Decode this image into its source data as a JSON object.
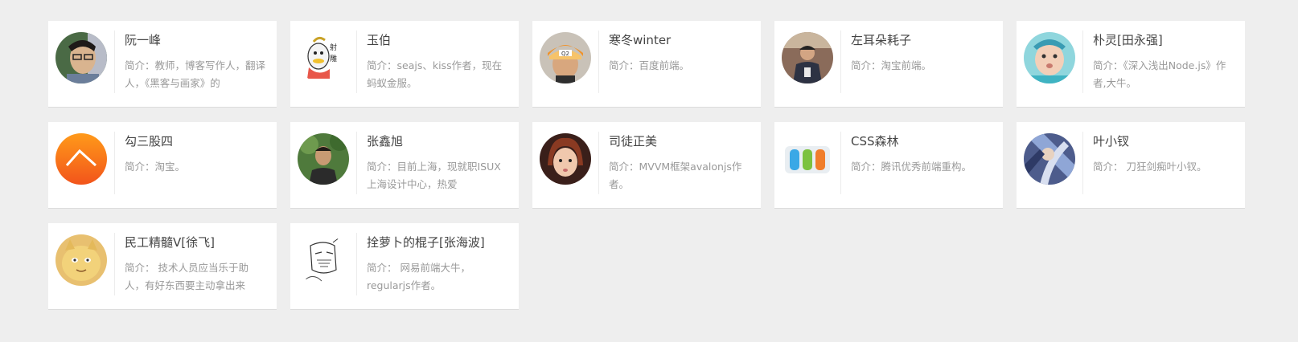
{
  "authors": [
    {
      "name": "阮一峰",
      "bio": "简介：教师，博客写作人，翻译人，《黑客与画家》的",
      "avatar": "photo-avatar"
    },
    {
      "name": "玉伯",
      "bio": "简介：seajs、kiss作者，现在蚂蚁金服。",
      "avatar": "cartoon-duck-avatar"
    },
    {
      "name": "寒冬winter",
      "bio": "简介：百度前端。",
      "avatar": "photo-avatar"
    },
    {
      "name": "左耳朵耗子",
      "bio": "简介：淘宝前端。",
      "avatar": "photo-avatar"
    },
    {
      "name": "朴灵[田永强]",
      "bio": "简介：《深入浅出Node.js》作者,大牛。",
      "avatar": "baby-photo-avatar"
    },
    {
      "name": "勾三股四",
      "bio": "简介：淘宝。",
      "avatar": "orange-logo-avatar"
    },
    {
      "name": "张鑫旭",
      "bio": "简介：目前上海，现就职ISUX上海设计中心，热爱",
      "avatar": "photo-avatar"
    },
    {
      "name": "司徒正美",
      "bio": "简介：MVVM框架avalonjs作者。",
      "avatar": "photo-avatar"
    },
    {
      "name": "CSS森林",
      "bio": "简介：腾讯优秀前端重构。",
      "avatar": "css-forest-logo-avatar"
    },
    {
      "name": "叶小钗",
      "bio": "简介： 刀狂剑痴叶小钗。",
      "avatar": "artwork-avatar"
    },
    {
      "name": "民工精髓V[徐飞]",
      "bio": "简介： 技术人员应当乐于助人，有好东西要主动拿出来",
      "avatar": "cartoon-cat-avatar"
    },
    {
      "name": "拴萝卜的棍子[张海波]",
      "bio": "简介： 网易前端大牛，regularjs作者。",
      "avatar": "sketch-avatar"
    }
  ]
}
